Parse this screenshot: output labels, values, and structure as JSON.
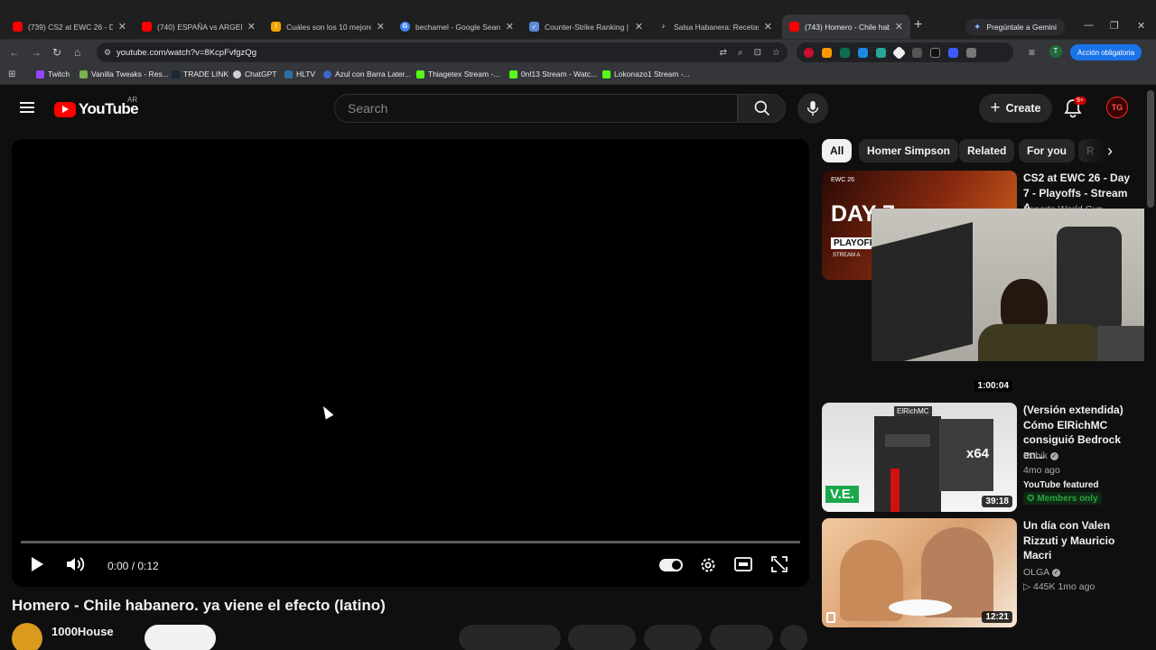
{
  "browser": {
    "tabs": [
      {
        "title": "(739) CS2 at EWC 26 - Day",
        "color": "#ff0000",
        "fav": ""
      },
      {
        "title": "(740) ESPAÑA vs ARGENTINA",
        "color": "#ff0000",
        "fav": ""
      },
      {
        "title": "Cuáles son los 10 mejores j",
        "color": "#f4a300",
        "fav": "!"
      },
      {
        "title": "bechamel - Google Search",
        "color": "#4285f4",
        "fav": "G"
      },
      {
        "title": "Counter-Strike Ranking | Va",
        "color": "#5b8bd8",
        "fav": "✓"
      },
      {
        "title": "Salsa Habanera: Recetas De",
        "color": "#222222",
        "fav": "♪"
      },
      {
        "title": "(743) Homero - Chile haba",
        "color": "#ff0000",
        "fav": ""
      }
    ],
    "gemini_label": "Pregúntale a Gemini",
    "url": "youtube.com/watch?v=8KcpFvfgzQg",
    "action_button": "Acción obligatoria",
    "profile_initial": "T",
    "bookmarks": [
      {
        "label": "Twitch",
        "color": "#9146ff"
      },
      {
        "label": "Vanilla Tweaks - Res...",
        "color": "#7bb04a"
      },
      {
        "label": "TRADE LINK",
        "color": "#1b2838"
      },
      {
        "label": "ChatGPT",
        "color": "#d0d0d0"
      },
      {
        "label": "HLTV",
        "color": "#2d6da3"
      },
      {
        "label": "Azul con Barra Later...",
        "color": "#3c67c8"
      },
      {
        "label": "Thiagetex Stream -...",
        "color": "#53fc18"
      },
      {
        "label": "0nl13 Stream - Watc...",
        "color": "#53fc18"
      },
      {
        "label": "Lokonazo1 Stream -...",
        "color": "#53fc18"
      }
    ]
  },
  "youtube": {
    "logo_text": "YouTube",
    "country_code": "AR",
    "search_placeholder": "Search",
    "create_label": "Create",
    "notif_count": "9+",
    "avatar_text": "TG"
  },
  "player": {
    "time": "0:00 / 0:12",
    "title": "Homero - Chile habanero. ya viene el efecto (latino)",
    "channel": "1000House"
  },
  "chips": [
    "All",
    "Homer Simpson",
    "Related",
    "For you",
    "R"
  ],
  "related": [
    {
      "title": "CS2 at EWC 26 - Day 7 - Playoffs - Stream A",
      "channel": "Esports World Cup",
      "duration": "1:00:04"
    },
    {
      "title": "(Versión extendida) Cómo ElRichMC consiguió Bedrock en...",
      "channel": "Rubik",
      "age": "4mo ago",
      "featured": "YouTube featured",
      "members": "Members only",
      "duration": "39:18",
      "thumb_text": "ElRichMC",
      "thumb_badge": "x64",
      "thumb_logo": "V.E."
    },
    {
      "title": "Un día con Valen Rizzuti y Mauricio Macri",
      "channel": "OLGA",
      "views": "445K",
      "age": "1mo ago",
      "duration": "12:21"
    }
  ],
  "thumb1": {
    "line1": "DAY 7",
    "line2": "PLAYOFFS",
    "line3": "STREAM A",
    "brand": "EWC 26"
  }
}
